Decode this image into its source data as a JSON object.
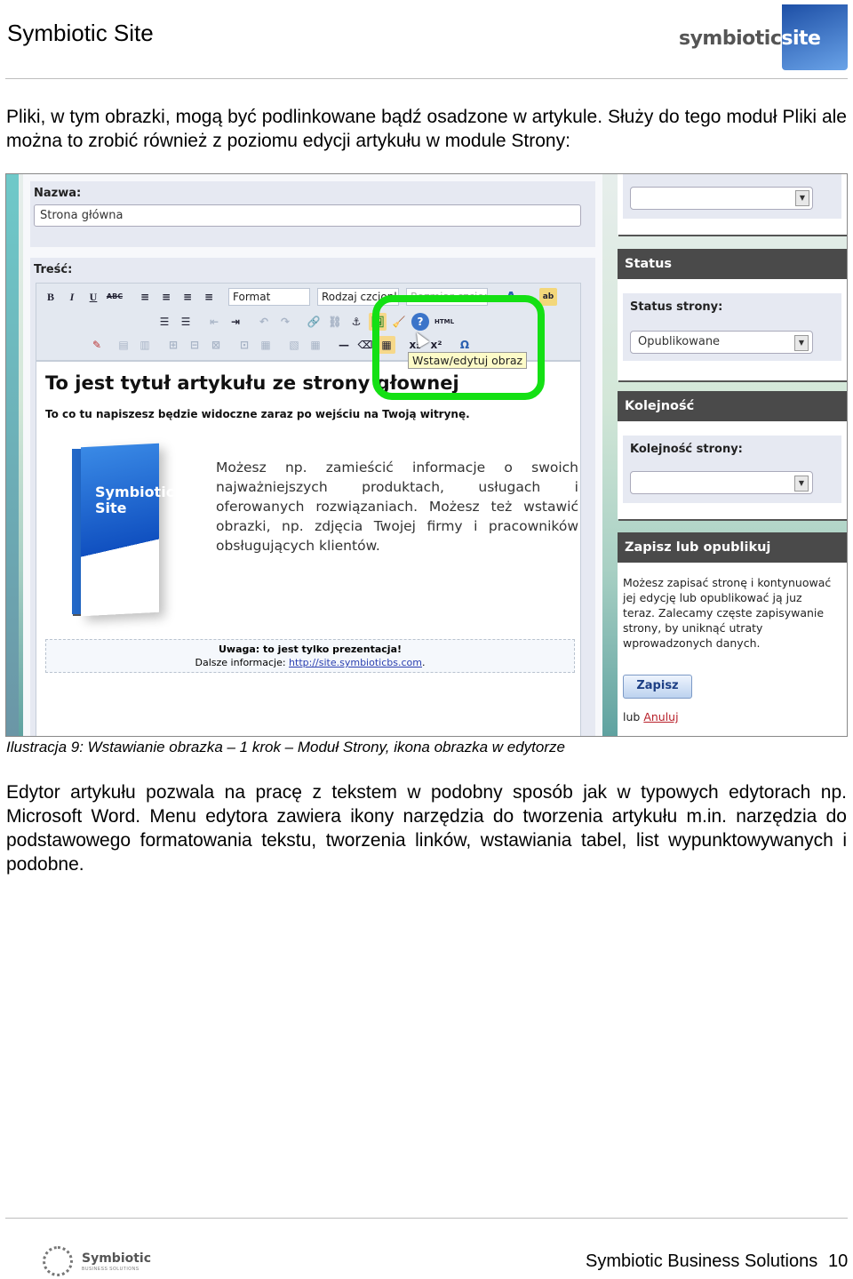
{
  "header": {
    "title": "Symbiotic Site",
    "logo_text_dark": "symbiotic",
    "logo_text_light": "site"
  },
  "intro_paragraph": "Pliki, w tym obrazki, mogą być podlinkowane bądź osadzone w artykule. Służy do tego moduł Pliki ale można to zrobić również z poziomu edycji artykułu w module Strony:",
  "screenshot": {
    "name_label": "Nazwa:",
    "name_value": "Strona główna",
    "content_label": "Treść:",
    "toolbar": {
      "row1": [
        "B",
        "I",
        "U",
        "ABC",
        "≡",
        "≡",
        "≡",
        "≡"
      ],
      "format_select": "Format",
      "font_select": "Rodzaj czcionk",
      "size_select": "Rozmiar czcion",
      "row2": [
        "☰",
        "☰",
        "⇤",
        "⇥",
        "↶",
        "↷",
        "🔗",
        "⛓",
        "⚓",
        "🖼",
        "🧹",
        "?",
        "HTML"
      ],
      "row3": [
        "✎",
        "▤",
        "▥",
        "⊞",
        "⊟",
        "⊠",
        "⊡",
        "▦",
        "▧",
        "▦",
        "—",
        "⌫",
        "▦",
        "x₂",
        "x²",
        "Ω"
      ]
    },
    "tooltip": "Wstaw/edytuj obraz",
    "highlight_color": "#14e014",
    "article": {
      "title": "To jest tytuł artykułu ze strony głownej",
      "subtitle": "To co tu napiszesz będzie widoczne zaraz po wejściu na Twoją witrynę.",
      "box_label": "Symbiotic Site",
      "body": "Możesz np. zamieścić informacje o swoich najważniejszych produktach, usługach i oferowanych rozwiązaniach. Możesz też wstawić obrazki, np. zdjęcia Twojej firmy i pracowników obsługujących klientów.",
      "note_title": "Uwaga: to jest tylko prezentacja!",
      "note_prefix": "Dalsze informacje: ",
      "note_link": "http://site.symbioticbs.com",
      "note_suffix": "."
    },
    "sidebar": {
      "top_select_value": "",
      "status": {
        "header": "Status",
        "label": "Status strony:",
        "value": "Opublikowane"
      },
      "order": {
        "header": "Kolejność",
        "label": "Kolejność strony:",
        "value": ""
      },
      "save": {
        "header": "Zapisz lub opublikuj",
        "text": "Możesz zapisać stronę i kontynuować jej edycję lub opublikować ją juz teraz. Zalecamy częste zapisywanie strony, by uniknąć utraty wprowadzonych danych.",
        "button": "Zapisz",
        "alt_prefix": "lub ",
        "alt_link": "Anuluj"
      }
    }
  },
  "caption": "Ilustracja 9: Wstawianie obrazka – 1 krok – Moduł Strony, ikona obrazka w edytorze",
  "body_paragraph": "Edytor artykułu pozwala na pracę z tekstem w podobny sposób jak w typowych edytorach np. Microsoft Word. Menu edytora zawiera ikony narzędzia do tworzenia artykułu m.in. narzędzia do podstawowego formatowania tekstu, tworzenia linków, wstawiania tabel, list wypunktowywanych i podobne.",
  "footer": {
    "logo_text": "Symbiotic",
    "logo_sub": "BUSINESS SOLUTIONS",
    "company": "Symbiotic Business Solutions",
    "page_number": "10"
  }
}
